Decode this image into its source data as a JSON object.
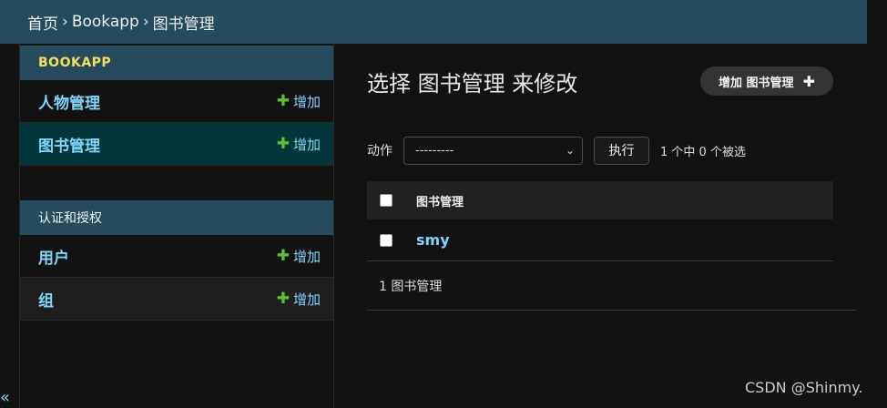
{
  "breadcrumbs": {
    "home": "首页",
    "separator1": "›",
    "app": "Bookapp",
    "separator2": "›",
    "current": "图书管理"
  },
  "sidebar": {
    "modules": [
      {
        "caption": "BOOKAPP",
        "models": [
          {
            "name": "人物管理",
            "add": "增加"
          },
          {
            "name": "图书管理",
            "add": "增加"
          }
        ]
      },
      {
        "caption": "认证和授权",
        "models": [
          {
            "name": "用户",
            "add": "增加"
          },
          {
            "name": "组",
            "add": "增加"
          }
        ]
      }
    ],
    "collapse_toggle": "«"
  },
  "main": {
    "title": "选择 图书管理 来修改",
    "add_button": "增加 图书管理",
    "add_button_icon": "✚",
    "actions": {
      "label": "动作",
      "select_value": "---------",
      "run_label": "执行",
      "selected_count": "1 个中 0 个被选"
    },
    "table": {
      "column_header": "图书管理",
      "rows": [
        "smy"
      ]
    },
    "paginator": "1 图书管理"
  },
  "watermark": "CSDN @Shinmy.",
  "colors": {
    "header_bg": "#264b5d",
    "link": "#81d4fa",
    "add_green": "#5fbd33",
    "current_row": "#00363a"
  }
}
